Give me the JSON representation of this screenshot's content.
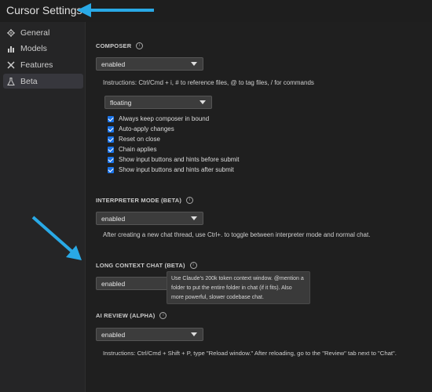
{
  "window": {
    "title": "Cursor Settings"
  },
  "sidebar": {
    "items": [
      {
        "label": "General",
        "icon": "gear-icon",
        "active": false
      },
      {
        "label": "Models",
        "icon": "chart-icon",
        "active": false
      },
      {
        "label": "Features",
        "icon": "tools-icon",
        "active": false
      },
      {
        "label": "Beta",
        "icon": "flask-icon",
        "active": true
      }
    ]
  },
  "composer": {
    "title": "COMPOSER",
    "mode_select": "enabled",
    "instructions": "Instructions: Ctrl/Cmd + i, # to reference files, @ to tag files, / for commands",
    "position_select": "floating",
    "options": [
      {
        "label": "Always keep composer in bound",
        "checked": true
      },
      {
        "label": "Auto-apply changes",
        "checked": true
      },
      {
        "label": "Reset on close",
        "checked": true
      },
      {
        "label": "Chain applies",
        "checked": true
      },
      {
        "label": "Show input buttons and hints before submit",
        "checked": true
      },
      {
        "label": "Show input buttons and hints after submit",
        "checked": true
      }
    ]
  },
  "interpreter": {
    "title": "INTERPRETER MODE (BETA)",
    "select": "enabled",
    "description": "After creating a new chat thread, use Ctrl+. to toggle between interpreter mode and normal chat."
  },
  "long_context": {
    "title": "LONG CONTEXT CHAT (BETA)",
    "select": "enabled",
    "tooltip": [
      "Use Claude's 200k token context window. @mention a",
      "folder to put the entire folder in chat (if it fits). Also",
      "more powerful, slower codebase chat."
    ]
  },
  "ai_review": {
    "title": "AI REVIEW (ALPHA)",
    "select": "enabled",
    "instructions": "Instructions: Ctrl/Cmd + Shift + P, type \"Reload window.\" After reloading, go to the \"Review\" tab next to \"Chat\"."
  },
  "colors": {
    "annotation_arrow": "#29a9e6",
    "checkbox": "#1a73e8",
    "background": "#1f1f1f"
  }
}
